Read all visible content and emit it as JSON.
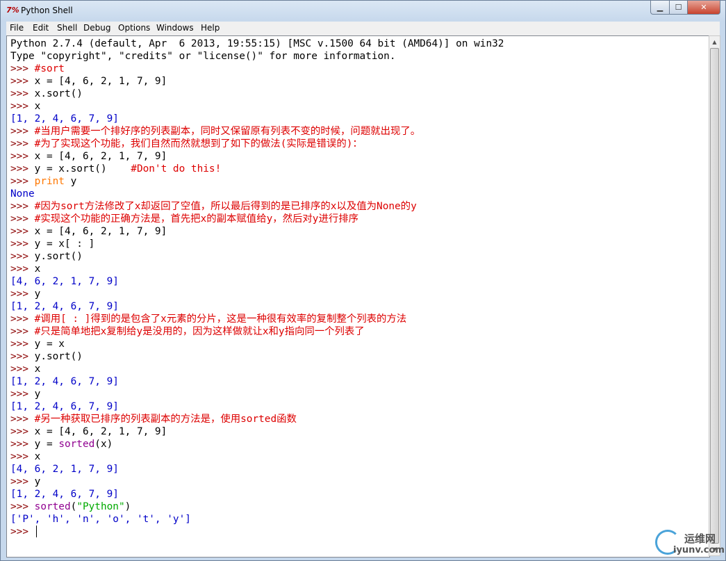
{
  "window": {
    "title": "Python Shell",
    "app_icon": "7%",
    "controls": {
      "minimize": "▁",
      "maximize": "☐",
      "close": "✕"
    }
  },
  "menu": [
    {
      "label": "File"
    },
    {
      "label": "Edit"
    },
    {
      "label": "Shell"
    },
    {
      "label": "Debug"
    },
    {
      "label": "Options"
    },
    {
      "label": "Windows"
    },
    {
      "label": "Help"
    }
  ],
  "shell": {
    "banner1": "Python 2.7.4 (default, Apr  6 2013, 19:55:15) [MSC v.1500 64 bit (AMD64)] on win32",
    "banner2": "Type \"copyright\", \"credits\" or \"license()\" for more information.",
    "prompt": ">>> ",
    "lines": {
      "l3": "#sort",
      "l4": "x = [4, 6, 2, 1, 7, 9]",
      "l5": "x.sort()",
      "l6": "x",
      "l7": "[1, 2, 4, 6, 7, 9]",
      "l8": "#当用户需要一个排好序的列表副本，同时又保留原有列表不变的时候，问题就出现了。",
      "l9": "#为了实现这个功能，我们自然而然就想到了如下的做法(实际是错误的)：",
      "l10": "x = [4, 6, 2, 1, 7, 9]",
      "l11a": "y = x.sort()    ",
      "l11b": "#Don't do this!",
      "l12a": "print",
      "l12b": " y",
      "l13": "None",
      "l14": "#因为sort方法修改了x却返回了空值，所以最后得到的是已排序的x以及值为None的y",
      "l15": "#实现这个功能的正确方法是，首先把x的副本赋值给y，然后对y进行排序",
      "l16": "x = [4, 6, 2, 1, 7, 9]",
      "l17": "y = x[ : ]",
      "l18": "y.sort()",
      "l19": "x",
      "l20": "[4, 6, 2, 1, 7, 9]",
      "l21": "y",
      "l22": "[1, 2, 4, 6, 7, 9]",
      "l23": "#调用[ : ]得到的是包含了x元素的分片，这是一种很有效率的复制整个列表的方法",
      "l24": "#只是简单地把x复制给y是没用的，因为这样做就让x和y指向同一个列表了",
      "l25": "y = x",
      "l26": "y.sort()",
      "l27": "x",
      "l28": "[1, 2, 4, 6, 7, 9]",
      "l29": "y",
      "l30": "[1, 2, 4, 6, 7, 9]",
      "l31": "#另一种获取已排序的列表副本的方法是，使用sorted函数",
      "l32": "x = [4, 6, 2, 1, 7, 9]",
      "l33a": "y = ",
      "l33b": "sorted",
      "l33c": "(x)",
      "l34": "x",
      "l35": "[4, 6, 2, 1, 7, 9]",
      "l36": "y",
      "l37": "[1, 2, 4, 6, 7, 9]",
      "l38a": "sorted",
      "l38b": "(",
      "l38c": "\"Python\"",
      "l38d": ")",
      "l39": "['P', 'h', 'n', 'o', 't', 'y']"
    }
  },
  "scrollbar": {
    "up_arrow": "▲",
    "down_arrow": "▼"
  },
  "watermark": {
    "line1": "运维网",
    "line2": "iyunv.com"
  }
}
